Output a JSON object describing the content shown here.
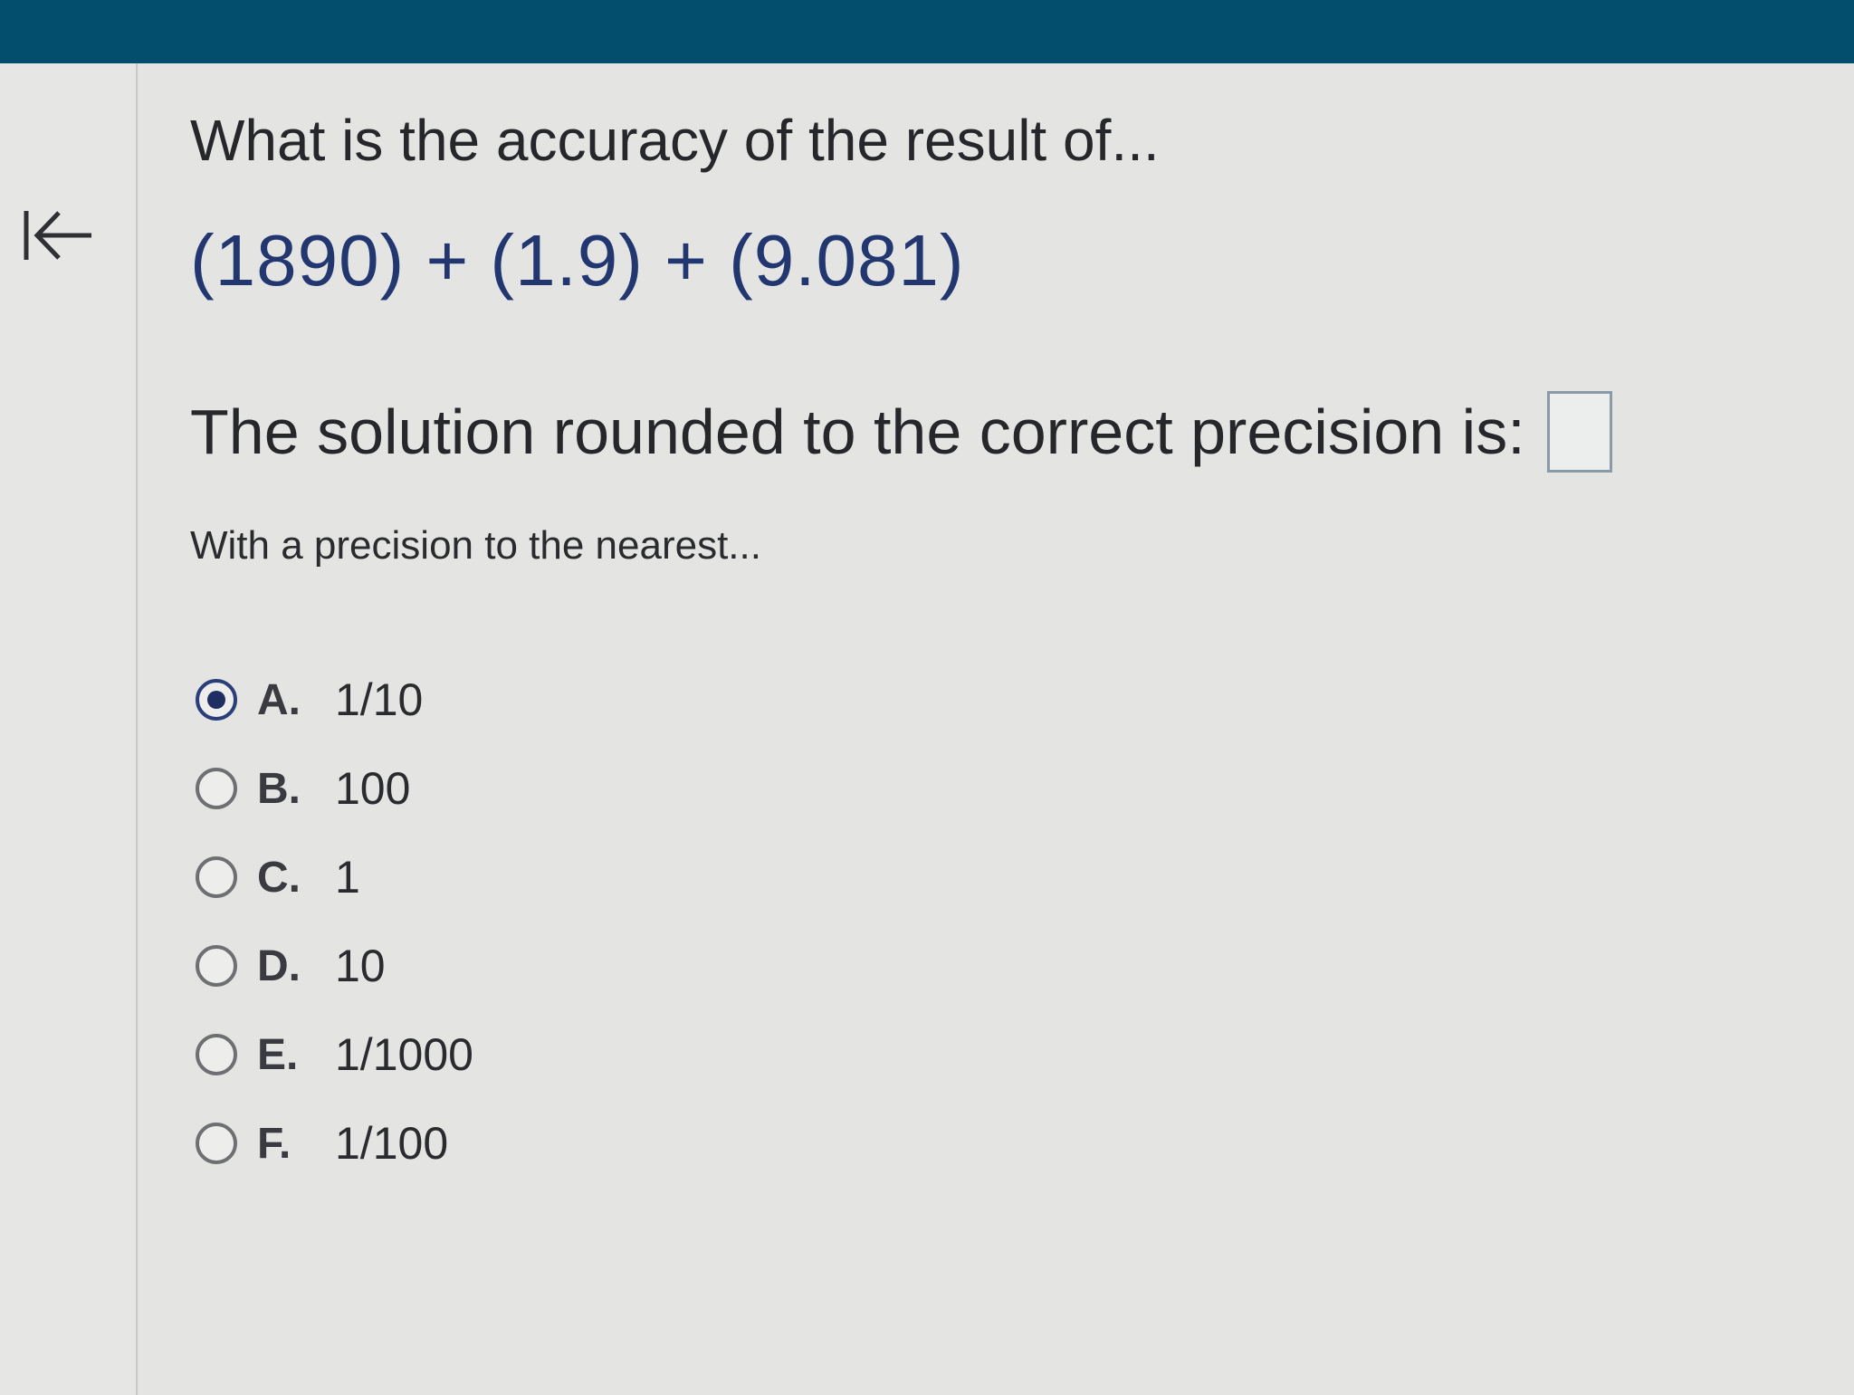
{
  "question": {
    "title": "What is the accuracy of the result of...",
    "expression": "(1890) + (1.9) + (9.081)",
    "solution_prompt": "The solution rounded to the correct precision is:",
    "answer_value": "",
    "precision_prompt": "With a precision to the nearest..."
  },
  "options": [
    {
      "letter": "A.",
      "value": "1/10",
      "selected": true
    },
    {
      "letter": "B.",
      "value": "100",
      "selected": false
    },
    {
      "letter": "C.",
      "value": "1",
      "selected": false
    },
    {
      "letter": "D.",
      "value": "10",
      "selected": false
    },
    {
      "letter": "E.",
      "value": "1/1000",
      "selected": false
    },
    {
      "letter": "F.",
      "value": "1/100",
      "selected": false
    }
  ],
  "icons": {
    "back": "collapse-left-arrow-icon"
  },
  "colors": {
    "top_bar": "#034e6c",
    "expression": "#22366f",
    "radio_selected": "#1e2e63"
  }
}
